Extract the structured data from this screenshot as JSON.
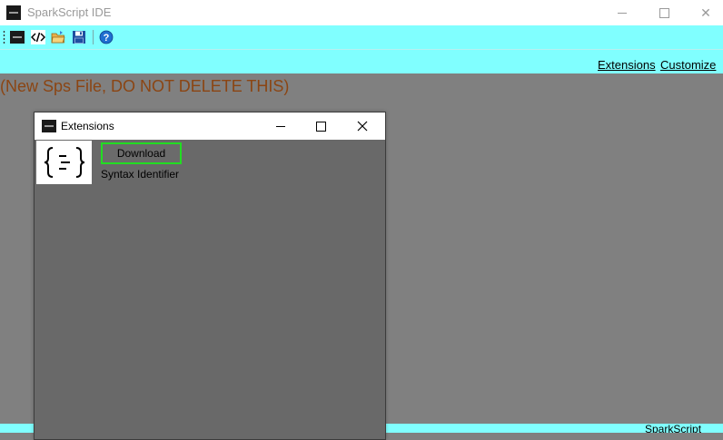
{
  "window": {
    "title": "SparkScript IDE",
    "controls": {
      "minimize": "minimize",
      "maximize": "maximize",
      "close": "✕"
    }
  },
  "toolbar": {
    "buttons": [
      {
        "name": "app-icon"
      },
      {
        "name": "code-icon"
      },
      {
        "name": "open-folder-icon"
      },
      {
        "name": "save-icon"
      },
      {
        "name": "help-icon"
      }
    ]
  },
  "menu": {
    "extensions": "Extensions",
    "customize": "Customize"
  },
  "workspace": {
    "file_label": "(New Sps File, DO NOT DELETE THIS)"
  },
  "dialog": {
    "title": "Extensions",
    "close_symbol": "✕",
    "extension": {
      "icon_glyph": "{☰}",
      "download_label": "Download",
      "name": "Syntax Identifier"
    }
  },
  "statusbar": {
    "text": "SparkScript"
  },
  "colors": {
    "accent": "#80ffff",
    "workspace": "#808080",
    "dialog_body": "#696969",
    "file_label": "#8b4513",
    "highlight": "#22dd22"
  }
}
